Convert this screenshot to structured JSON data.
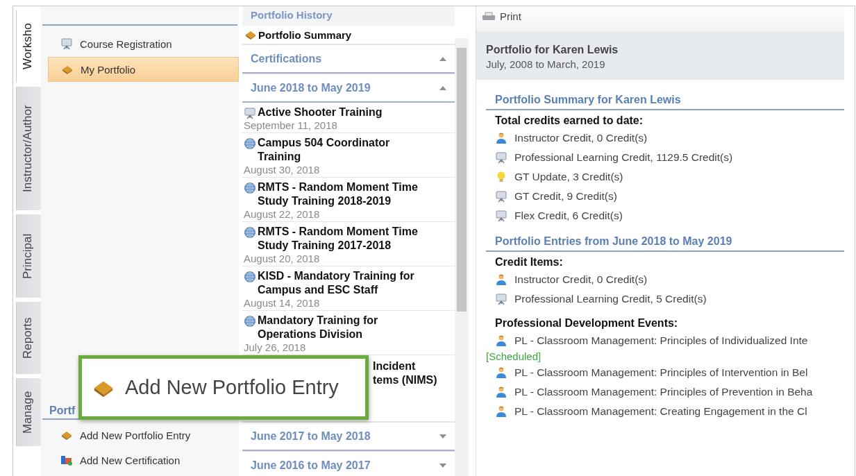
{
  "tabs": [
    {
      "label": "Worksho",
      "selected": true
    },
    {
      "label": "Instructor/Author",
      "selected": false
    },
    {
      "label": "Principal",
      "selected": false
    },
    {
      "label": "Reports",
      "selected": false
    },
    {
      "label": "Manage",
      "selected": false
    }
  ],
  "nav": {
    "items": [
      {
        "label": "Course Registration",
        "kind": "monitor",
        "selected": false
      },
      {
        "label": "My Portfolio",
        "kind": "portfolio",
        "selected": true
      }
    ],
    "section_heading": "Portf",
    "actions": [
      {
        "label": "Add New Portfolio Entry",
        "kind": "portfolio"
      },
      {
        "label": "Add New Certification",
        "kind": "certificate"
      }
    ]
  },
  "history": {
    "title": "Portfolio History",
    "summary": "Portfolio Summary",
    "groups": [
      {
        "label": "Certifications",
        "expanded": true
      },
      {
        "label": "June 2018 to May 2019",
        "expanded": true,
        "entries": [
          {
            "title": "Active Shooter Training",
            "date": "September 11, 2018",
            "kind": "monitor"
          },
          {
            "title": "Campus 504 Coordinator Training",
            "date": "August 30, 2018",
            "kind": "globe"
          },
          {
            "title": "RMTS - Random Moment Time Study Training 2018-2019",
            "date": "August 22, 2018",
            "kind": "globe"
          },
          {
            "title": "RMTS - Random Moment Time Study Training 2017-2018",
            "date": "August 20, 2018",
            "kind": "globe"
          },
          {
            "title": "KISD - Mandatory Training for Campus and ESC Staff",
            "date": "August 14, 2018",
            "kind": "globe"
          },
          {
            "title": "Mandatory Training for Operations Division",
            "date": "July 26, 2018",
            "kind": "globe"
          },
          {
            "title_lines": [
              "Incident",
              "tems (NIMS)"
            ],
            "kind": "partial"
          }
        ]
      },
      {
        "label": "June 2017 to May 2018",
        "expanded": false
      },
      {
        "label": "June 2016 to May 2017",
        "expanded": false
      }
    ]
  },
  "report": {
    "print": "Print",
    "header": {
      "title": "Portfolio for Karen Lewis",
      "period": "July, 2008 to March, 2019"
    },
    "sections": [
      {
        "heading": "Portfolio Summary for Karen Lewis",
        "groups": [
          {
            "label": "Total credits earned to date:",
            "items": [
              {
                "text": "Instructor Credit, 0 Credit(s)",
                "kind": "person"
              },
              {
                "text": "Professional Learning Credit, 1129.5 Credit(s)",
                "kind": "monitor"
              },
              {
                "text": "GT Update, 3 Credit(s)",
                "kind": "bulb"
              },
              {
                "text": "GT Credit, 9 Credit(s)",
                "kind": "monitor"
              },
              {
                "text": "Flex Credit, 6 Credit(s)",
                "kind": "monitor"
              }
            ]
          }
        ]
      },
      {
        "heading": "Portfolio Entries from June 2018 to May 2019",
        "groups": [
          {
            "label": "Credit Items:",
            "items": [
              {
                "text": "Instructor Credit, 0 Credit(s)",
                "kind": "person"
              },
              {
                "text": "Professional Learning Credit, 5 Credit(s)",
                "kind": "monitor"
              }
            ]
          },
          {
            "label": "Professional Development Events:",
            "items": [
              {
                "text": "PL - Classroom Management: Principles of Individualized Inte",
                "kind": "person",
                "status": "[Scheduled]"
              },
              {
                "text": "PL - Classroom Management: Principles of Intervention in Bel",
                "kind": "person"
              },
              {
                "text": "PL - Classroom Management: Principles of Prevention in Beha",
                "kind": "person"
              },
              {
                "text": "PL - Classroom Management: Creating Engagement in the Cl",
                "kind": "person"
              }
            ]
          }
        ]
      }
    ]
  },
  "callout": {
    "label": "Add New Portfolio Entry",
    "kind": "portfolio"
  }
}
